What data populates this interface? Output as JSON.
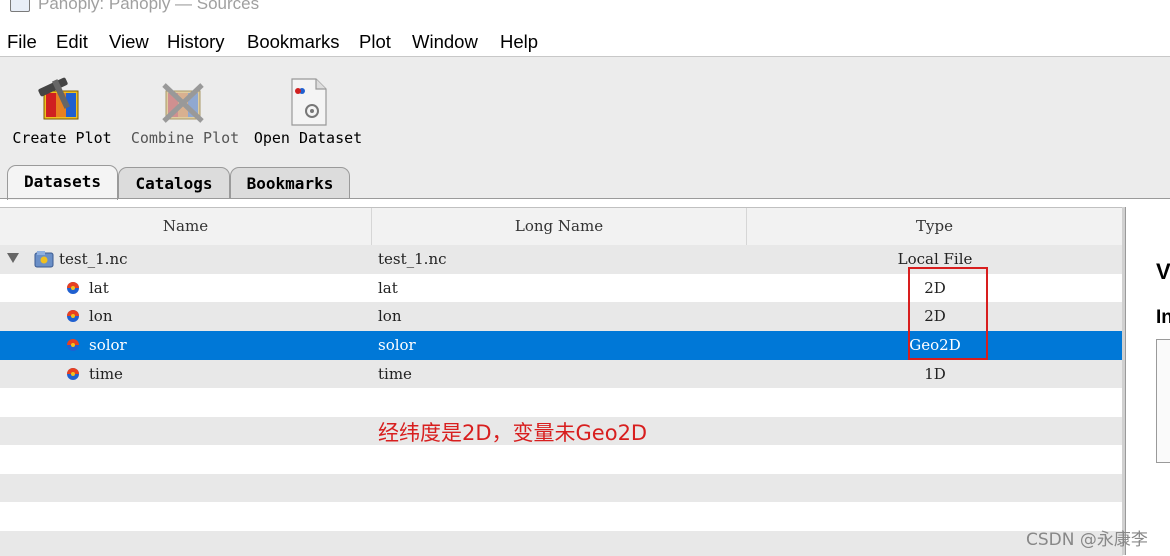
{
  "window": {
    "title": "Panoply: Panoply — Sources"
  },
  "menu": [
    "File",
    "Edit",
    "View",
    "History",
    "Bookmarks",
    "Plot",
    "Window",
    "Help"
  ],
  "toolbar": {
    "create_plot": "Create Plot",
    "combine_plot": "Combine Plot",
    "open_dataset": "Open Dataset"
  },
  "tabs": [
    "Datasets",
    "Catalogs",
    "Bookmarks"
  ],
  "table": {
    "headers": {
      "name": "Name",
      "long_name": "Long Name",
      "type": "Type"
    },
    "rows": [
      {
        "name": "test_1.nc",
        "long_name": "test_1.nc",
        "type": "Local File"
      },
      {
        "name": "lat",
        "long_name": "lat",
        "type": "2D"
      },
      {
        "name": "lon",
        "long_name": "lon",
        "type": "2D"
      },
      {
        "name": "solor",
        "long_name": "solor",
        "type": "Geo2D"
      },
      {
        "name": "time",
        "long_name": "time",
        "type": "1D"
      }
    ]
  },
  "annotation": "经纬度是2D，变量未Geo2D",
  "right_panel": {
    "heading1": "V",
    "heading2": "In"
  },
  "watermark": "CSDN @永康李",
  "colors": {
    "selection": "#0078d7",
    "annotation": "#d81e1e"
  }
}
